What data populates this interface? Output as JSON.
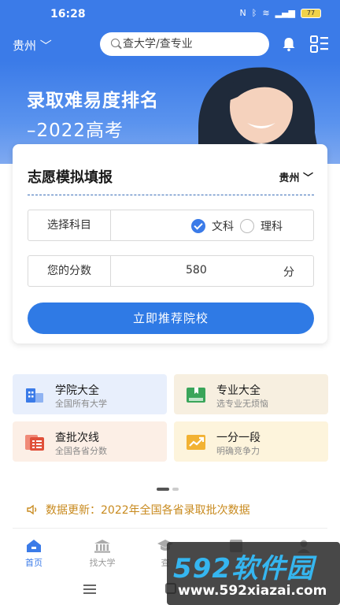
{
  "status": {
    "time": "16:28",
    "battery": "77"
  },
  "header": {
    "city": "贵州",
    "search_placeholder": "查大学/查专业"
  },
  "banner": {
    "title": "录取难易度排名",
    "subtitle": "–2022高考"
  },
  "form": {
    "title": "志愿模拟填报",
    "province": "贵州",
    "subject_label": "选择科目",
    "options": [
      {
        "label": "文科",
        "checked": true
      },
      {
        "label": "理科",
        "checked": false
      }
    ],
    "score_label": "您的分数",
    "score_value": "580",
    "score_unit": "分",
    "submit_label": "立即推荐院校"
  },
  "features": [
    {
      "title": "学院大全",
      "subtitle": "全国所有大学",
      "icon": "building-icon",
      "color": "#3b7be8"
    },
    {
      "title": "专业大全",
      "subtitle": "选专业无烦恼",
      "icon": "book-icon",
      "color": "#3aa55a"
    },
    {
      "title": "查批次线",
      "subtitle": "全国各省分数",
      "icon": "list-icon",
      "color": "#e0503a"
    },
    {
      "title": "一分一段",
      "subtitle": "明确竞争力",
      "icon": "trend-icon",
      "color": "#f2b233"
    }
  ],
  "notice": {
    "text": "数据更新：2022年全国各省录取批次数据"
  },
  "tabs": [
    {
      "label": "首页",
      "active": true
    },
    {
      "label": "找大学",
      "active": false
    },
    {
      "label": "查",
      "active": false
    },
    {
      "label": "",
      "active": false
    },
    {
      "label": "",
      "active": false
    }
  ],
  "watermark": {
    "brand": "592软件园",
    "url": "www.592xiazai.com"
  },
  "colors": {
    "accent": "#3b7be8",
    "notice": "#c88a1e"
  }
}
